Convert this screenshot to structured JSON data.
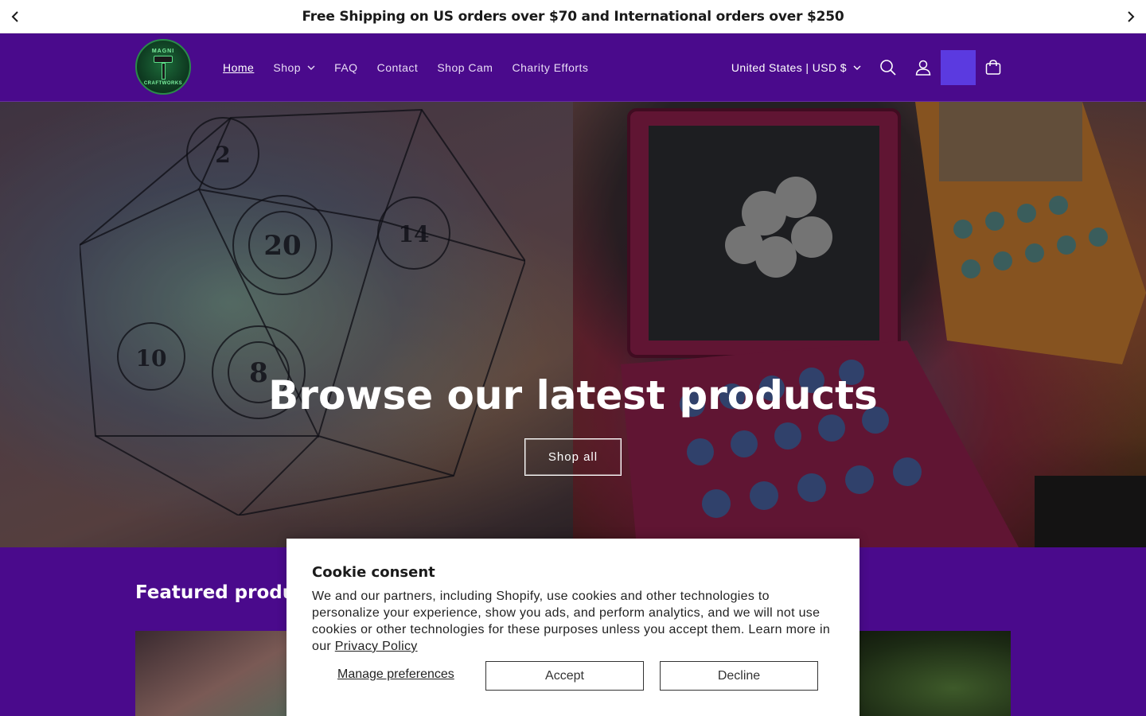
{
  "announcement": {
    "text": "Free Shipping on US orders over $70 and International orders over $250",
    "prev_icon": "chevron-left-icon",
    "next_icon": "chevron-right-icon"
  },
  "header": {
    "logo": {
      "top_text": "MAGNI",
      "bottom_text": "CRAFTWORKS"
    },
    "nav": [
      {
        "label": "Home",
        "active": true
      },
      {
        "label": "Shop",
        "has_dropdown": true
      },
      {
        "label": "FAQ"
      },
      {
        "label": "Contact"
      },
      {
        "label": "Shop Cam"
      },
      {
        "label": "Charity Efforts"
      }
    ],
    "currency": "United States | USD $",
    "icons": [
      "search-icon",
      "account-icon",
      "cart-icon"
    ]
  },
  "hero": {
    "title": "Browse our latest products",
    "button": "Shop all"
  },
  "featured": {
    "title": "Featured products"
  },
  "cookie": {
    "title": "Cookie consent",
    "body": "We and our partners, including Shopify, use cookies and other technologies to personalize your experience, show you ads, and perform analytics, and we will not use cookies or other technologies for these purposes unless you accept them. Learn more in our ",
    "policy_link": "Privacy Policy",
    "manage": "Manage preferences",
    "accept": "Accept",
    "decline": "Decline"
  },
  "colors": {
    "brand_purple": "#4a0a8c",
    "highlight": "#5b3ae0",
    "logo_green": "#2a8a4a"
  }
}
